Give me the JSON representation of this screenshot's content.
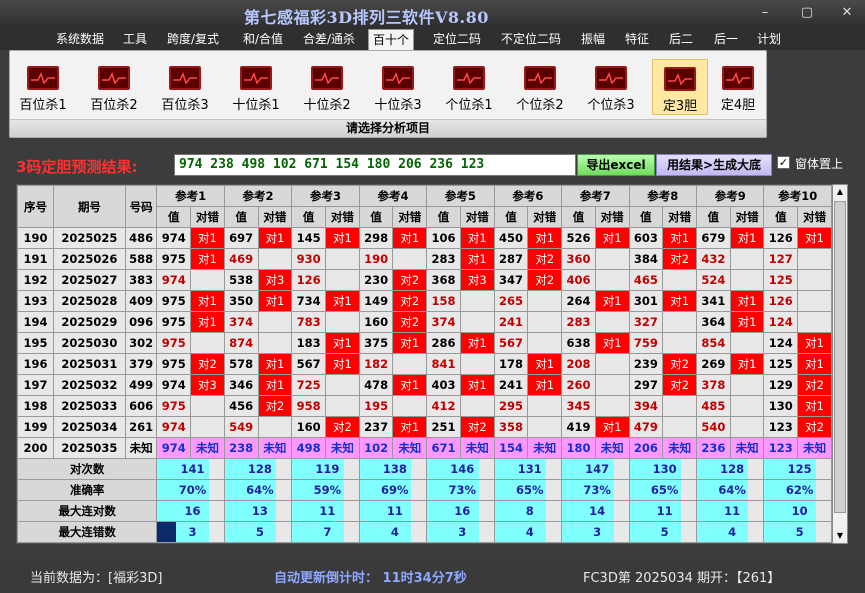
{
  "app": {
    "title": "第七感福彩3D排列三软件V8.80"
  },
  "window": {
    "minimize": "–",
    "restore": "▢",
    "close": "✕"
  },
  "menu": [
    "系统数据",
    "工具",
    "跨度/复式",
    "和/合值",
    "合差/通杀",
    "百十个",
    "定位二码",
    "不定位二码",
    "振幅",
    "特征",
    "后二",
    "后一",
    "计划"
  ],
  "menu_active": "百十个",
  "ribbon": {
    "buttons": [
      "百位杀1",
      "百位杀2",
      "百位杀3",
      "十位杀1",
      "十位杀2",
      "十位杀3",
      "个位杀1",
      "个位杀2",
      "个位杀3",
      "定3胆",
      "定4胆"
    ],
    "selected": "定3胆",
    "footer": "请选择分析项目"
  },
  "result": {
    "label": "3码定胆预测结果:",
    "value": "974  238  498  102  671  154  180  206  236  123",
    "export_button": "导出excel",
    "generate_button": "用结果>生成大底",
    "on_top_label": "窗体置上",
    "on_top_checked": "✓"
  },
  "table": {
    "head": {
      "seq": "序号",
      "period": "期号",
      "code": "号码",
      "val": "值",
      "chk": "对错"
    },
    "refs": [
      "参考1",
      "参考2",
      "参考3",
      "参考4",
      "参考5",
      "参考6",
      "参考7",
      "参考8",
      "参考9",
      "参考10"
    ],
    "rows": [
      {
        "seq": "190",
        "period": "2025025",
        "code": "486",
        "cells": [
          [
            "974",
            "对1"
          ],
          [
            "697",
            "对1"
          ],
          [
            "145",
            "对1"
          ],
          [
            "298",
            "对1"
          ],
          [
            "106",
            "对1"
          ],
          [
            "450",
            "对1"
          ],
          [
            "526",
            "对1"
          ],
          [
            "603",
            "对1"
          ],
          [
            "679",
            "对1"
          ],
          [
            "126",
            "对1"
          ]
        ]
      },
      {
        "seq": "191",
        "period": "2025026",
        "code": "588",
        "cells": [
          [
            "975",
            "对1"
          ],
          [
            "469",
            ""
          ],
          [
            "930",
            ""
          ],
          [
            "190",
            ""
          ],
          [
            "283",
            "对1"
          ],
          [
            "287",
            "对2"
          ],
          [
            "360",
            ""
          ],
          [
            "384",
            "对2"
          ],
          [
            "432",
            ""
          ],
          [
            "127",
            ""
          ]
        ]
      },
      {
        "seq": "192",
        "period": "2025027",
        "code": "383",
        "cells": [
          [
            "974",
            ""
          ],
          [
            "538",
            "对3"
          ],
          [
            "126",
            ""
          ],
          [
            "230",
            "对2"
          ],
          [
            "368",
            "对3"
          ],
          [
            "347",
            "对2"
          ],
          [
            "406",
            ""
          ],
          [
            "465",
            ""
          ],
          [
            "524",
            ""
          ],
          [
            "125",
            ""
          ]
        ]
      },
      {
        "seq": "193",
        "period": "2025028",
        "code": "409",
        "cells": [
          [
            "975",
            "对1"
          ],
          [
            "350",
            "对1"
          ],
          [
            "734",
            "对1"
          ],
          [
            "149",
            "对2"
          ],
          [
            "158",
            ""
          ],
          [
            "265",
            ""
          ],
          [
            "264",
            "对1"
          ],
          [
            "301",
            "对1"
          ],
          [
            "341",
            "对1"
          ],
          [
            "126",
            ""
          ]
        ]
      },
      {
        "seq": "194",
        "period": "2025029",
        "code": "096",
        "cells": [
          [
            "975",
            "对1"
          ],
          [
            "374",
            ""
          ],
          [
            "783",
            ""
          ],
          [
            "160",
            "对2"
          ],
          [
            "374",
            ""
          ],
          [
            "241",
            ""
          ],
          [
            "283",
            ""
          ],
          [
            "327",
            ""
          ],
          [
            "364",
            "对1"
          ],
          [
            "124",
            ""
          ]
        ]
      },
      {
        "seq": "195",
        "period": "2025030",
        "code": "302",
        "cells": [
          [
            "975",
            ""
          ],
          [
            "874",
            ""
          ],
          [
            "183",
            "对1"
          ],
          [
            "375",
            "对1"
          ],
          [
            "286",
            "对1"
          ],
          [
            "567",
            ""
          ],
          [
            "638",
            "对1"
          ],
          [
            "759",
            ""
          ],
          [
            "854",
            ""
          ],
          [
            "124",
            "对1"
          ]
        ]
      },
      {
        "seq": "196",
        "period": "2025031",
        "code": "379",
        "cells": [
          [
            "975",
            "对2"
          ],
          [
            "578",
            "对1"
          ],
          [
            "567",
            "对1"
          ],
          [
            "182",
            ""
          ],
          [
            "841",
            ""
          ],
          [
            "178",
            "对1"
          ],
          [
            "208",
            ""
          ],
          [
            "239",
            "对2"
          ],
          [
            "269",
            "对1"
          ],
          [
            "125",
            "对1"
          ]
        ]
      },
      {
        "seq": "197",
        "period": "2025032",
        "code": "499",
        "cells": [
          [
            "974",
            "对3"
          ],
          [
            "346",
            "对1"
          ],
          [
            "725",
            ""
          ],
          [
            "478",
            "对1"
          ],
          [
            "403",
            "对1"
          ],
          [
            "241",
            "对1"
          ],
          [
            "260",
            ""
          ],
          [
            "297",
            "对2"
          ],
          [
            "378",
            ""
          ],
          [
            "129",
            "对2"
          ]
        ]
      },
      {
        "seq": "198",
        "period": "2025033",
        "code": "606",
        "cells": [
          [
            "975",
            ""
          ],
          [
            "456",
            "对2"
          ],
          [
            "958",
            ""
          ],
          [
            "195",
            ""
          ],
          [
            "412",
            ""
          ],
          [
            "295",
            ""
          ],
          [
            "345",
            ""
          ],
          [
            "394",
            ""
          ],
          [
            "485",
            ""
          ],
          [
            "130",
            "对1"
          ]
        ]
      },
      {
        "seq": "199",
        "period": "2025034",
        "code": "261",
        "cells": [
          [
            "974",
            ""
          ],
          [
            "549",
            ""
          ],
          [
            "160",
            "对2"
          ],
          [
            "237",
            "对1"
          ],
          [
            "251",
            "对2"
          ],
          [
            "358",
            ""
          ],
          [
            "419",
            "对1"
          ],
          [
            "479",
            ""
          ],
          [
            "540",
            ""
          ],
          [
            "123",
            "对2"
          ]
        ]
      }
    ],
    "pred": {
      "seq": "200",
      "period": "2025035",
      "code": "未知",
      "unknown": "未知",
      "values": [
        "974",
        "238",
        "498",
        "102",
        "671",
        "154",
        "180",
        "206",
        "236",
        "123"
      ]
    },
    "stats": [
      {
        "label": "对次数",
        "values": [
          "141",
          "128",
          "119",
          "138",
          "146",
          "131",
          "147",
          "130",
          "128",
          "125"
        ]
      },
      {
        "label": "准确率",
        "values": [
          "70%",
          "64%",
          "59%",
          "69%",
          "73%",
          "65%",
          "73%",
          "65%",
          "64%",
          "62%"
        ]
      },
      {
        "label": "最大连对数",
        "values": [
          "16",
          "13",
          "11",
          "11",
          "16",
          "8",
          "14",
          "11",
          "11",
          "10"
        ]
      },
      {
        "label": "最大连错数",
        "values": [
          "3",
          "5",
          "7",
          "4",
          "3",
          "4",
          "3",
          "5",
          "4",
          "5"
        ]
      }
    ]
  },
  "status": {
    "current": "当前数据为：[福彩3D]",
    "countdown": "自动更新倒计时：  11时34分7秒",
    "period": "FC3D第 2025034 期开：【261】"
  },
  "colors": {
    "hit_red": "#ff0000",
    "stat_cyan": "#80ffff",
    "pred_pink": "#ff99ff",
    "title_blue": "#b7c8ff"
  }
}
